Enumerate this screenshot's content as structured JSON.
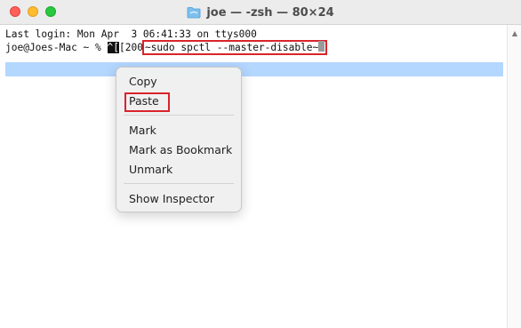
{
  "window": {
    "title": "joe — -zsh — 80×24",
    "folder_icon": "folder-icon"
  },
  "terminal": {
    "last_login": "Last login: Mon Apr  3 06:41:33 on ttys000",
    "prompt": "joe@Joes-Mac ~ % ",
    "control_seq": "^[",
    "bracket_text": "[200",
    "command": "~sudo spctl --master-disable~"
  },
  "context_menu": {
    "copy": "Copy",
    "paste": "Paste",
    "mark": "Mark",
    "mark_bookmark": "Mark as Bookmark",
    "unmark": "Unmark",
    "show_inspector": "Show Inspector"
  },
  "colors": {
    "highlight_box": "#d9232b",
    "selection": "#b4d7ff"
  }
}
